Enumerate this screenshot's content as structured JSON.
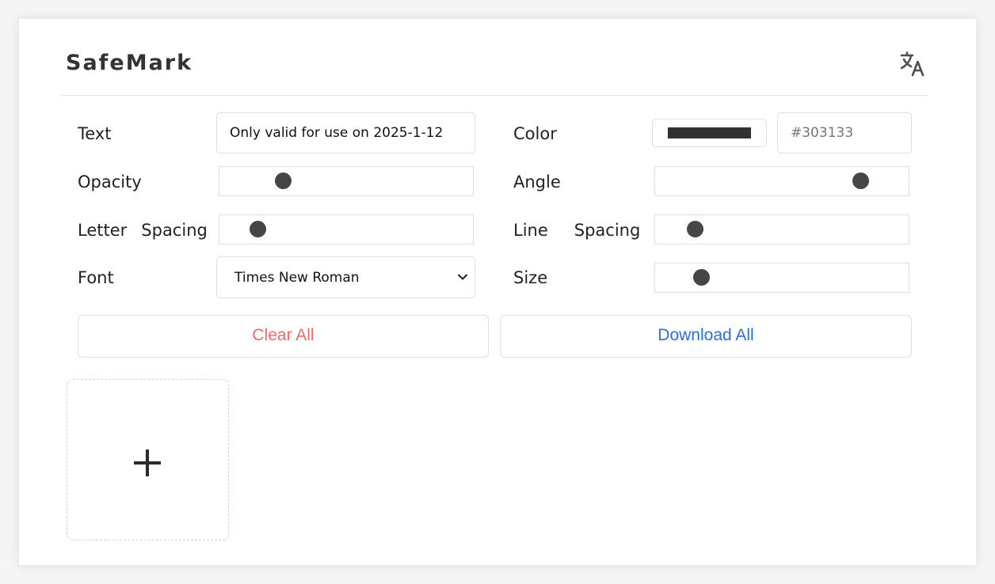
{
  "app": {
    "title": "SafeMark",
    "language_icon": "translate-icon"
  },
  "form": {
    "text": {
      "label": "Text",
      "value": "Only valid for use on 2025-1-12"
    },
    "color": {
      "label": "Color",
      "value": "#303133",
      "placeholder": "#303133",
      "swatch": "#303133"
    },
    "opacity": {
      "label": "Opacity",
      "value_fraction": 0.25
    },
    "angle": {
      "label": "Angle",
      "value_fraction": 0.81
    },
    "letter_spacing": {
      "label_part1": "Letter",
      "label_part2": "Spacing",
      "value_fraction": 0.15
    },
    "line_spacing": {
      "label_part1": "Line",
      "label_part2": "Spacing",
      "value_fraction": 0.155
    },
    "font": {
      "label": "Font",
      "value": "Times New Roman"
    },
    "size": {
      "label": "Size",
      "value_fraction": 0.18
    }
  },
  "actions": {
    "clear_label": "Clear All",
    "clear_color": "#e66b6b",
    "download_label": "Download All",
    "download_color": "#2e6ecf"
  },
  "upload": {
    "icon": "plus-icon"
  }
}
